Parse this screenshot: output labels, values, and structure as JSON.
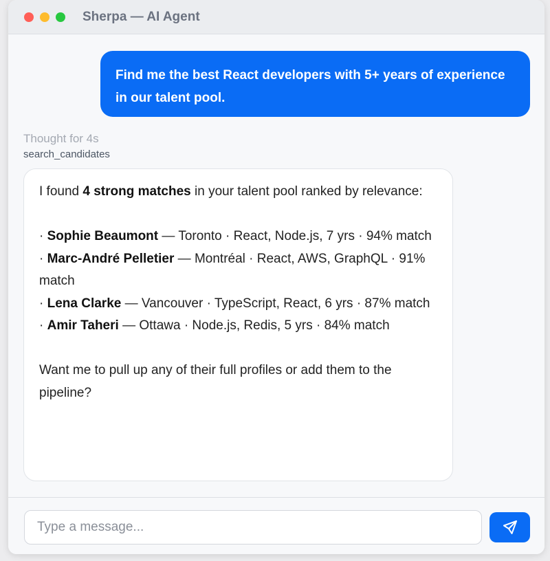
{
  "window": {
    "title": "Sherpa — AI Agent"
  },
  "user_message": "Find me the best React developers with 5+ years of experience in our talent pool.",
  "agent": {
    "thought": "Thought for 4s",
    "tool_call": "search_candidates",
    "intro_pre": "I found ",
    "intro_bold": "4 strong matches",
    "intro_post": " in your talent pool ranked by relevance:",
    "candidates": [
      {
        "name": "Sophie Beaumont",
        "details": " — Toronto · React, Node.js, 7 yrs · 94% match"
      },
      {
        "name": "Marc-André Pelletier",
        "details": " — Montréal · React, AWS, GraphQL · 91% match"
      },
      {
        "name": "Lena Clarke",
        "details": " — Vancouver · TypeScript, React, 6 yrs · 87% match"
      },
      {
        "name": "Amir Taheri",
        "details": " — Ottawa · Node.js, Redis, 5 yrs · 84% match"
      }
    ],
    "closing": "Want me to pull up any of their full profiles or add them to the pipeline?"
  },
  "composer": {
    "placeholder": "Type a message..."
  },
  "icons": {
    "send": "send-icon"
  },
  "colors": {
    "accent": "#0a6cf5"
  }
}
